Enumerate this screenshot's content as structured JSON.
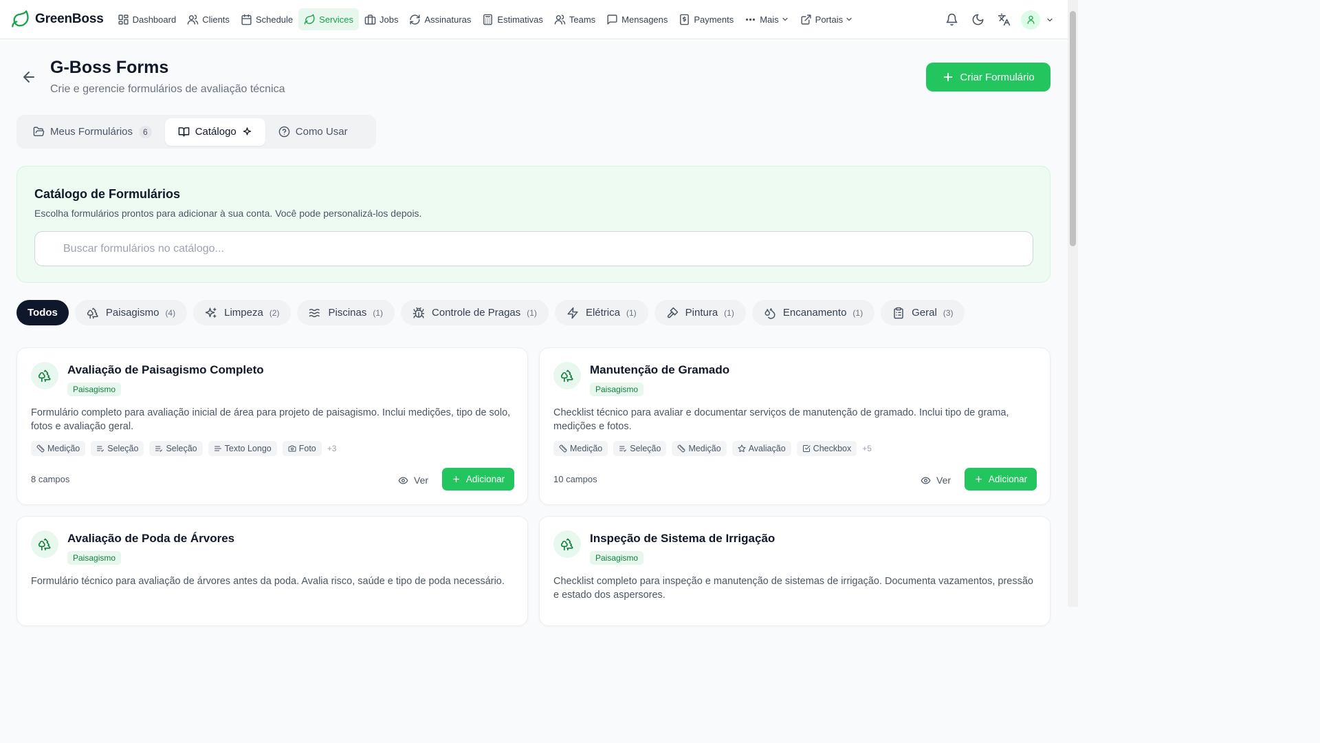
{
  "brand": {
    "name": "GreenBoss",
    "icon": "leaf-icon",
    "accent": "#22c55e"
  },
  "nav": {
    "items": [
      {
        "label": "Dashboard",
        "icon": "grid-icon"
      },
      {
        "label": "Clients",
        "icon": "users-icon"
      },
      {
        "label": "Schedule",
        "icon": "calendar-icon"
      },
      {
        "label": "Services",
        "icon": "leaf-icon",
        "active": true
      },
      {
        "label": "Jobs",
        "icon": "briefcase-icon"
      },
      {
        "label": "Assinaturas",
        "icon": "refresh-icon"
      },
      {
        "label": "Estimativas",
        "icon": "calculator-icon"
      },
      {
        "label": "Teams",
        "icon": "team-icon"
      },
      {
        "label": "Mensagens",
        "icon": "message-icon"
      },
      {
        "label": "Payments",
        "icon": "dollar-icon"
      },
      {
        "label": "Mais",
        "icon": "dots-icon"
      },
      {
        "label": "Portais",
        "icon": "external-link-icon"
      }
    ]
  },
  "header": {
    "title": "G-Boss Forms",
    "subtitle": "Crie e gerencie formulários de avaliação técnica",
    "create_label": "Criar Formulário"
  },
  "tabs": [
    {
      "label": "Meus Formulários",
      "count": "6",
      "icon": "folder-icon"
    },
    {
      "label": "Catálogo",
      "icon": "book-icon",
      "active": true
    },
    {
      "label": "Como Usar",
      "icon": "help-icon"
    }
  ],
  "catalog": {
    "title": "Catálogo de Formulários",
    "description": "Escolha formulários prontos para adicionar à sua conta. Você pode personalizá-los depois.",
    "search_placeholder": "Buscar formulários no catálogo..."
  },
  "categories": [
    {
      "label": "Todos",
      "active": true
    },
    {
      "label": "Paisagismo",
      "count": "(4)",
      "icon": "tree-icon"
    },
    {
      "label": "Limpeza",
      "count": "(2)",
      "icon": "sparkles-icon"
    },
    {
      "label": "Piscinas",
      "count": "(1)",
      "icon": "waves-icon"
    },
    {
      "label": "Controle de Pragas",
      "count": "(1)",
      "icon": "bug-icon"
    },
    {
      "label": "Elétrica",
      "count": "(1)",
      "icon": "zap-icon"
    },
    {
      "label": "Pintura",
      "count": "(1)",
      "icon": "paintbrush-icon"
    },
    {
      "label": "Encanamento",
      "count": "(1)",
      "icon": "droplets-icon"
    },
    {
      "label": "Geral",
      "count": "(3)",
      "icon": "clipboard-icon"
    }
  ],
  "forms": [
    {
      "title": "Avaliação de Paisagismo Completo",
      "category": "Paisagismo",
      "description": "Formulário completo para avaliação inicial de área para projeto de paisagismo. Inclui medições, tipo de solo, fotos e avaliação geral.",
      "fields": [
        {
          "label": "Medição",
          "icon": "ruler-icon"
        },
        {
          "label": "Seleção",
          "icon": "list-check-icon"
        },
        {
          "label": "Seleção",
          "icon": "list-check-icon"
        },
        {
          "label": "Texto Longo",
          "icon": "text-lines-icon"
        },
        {
          "label": "Foto",
          "icon": "camera-icon"
        }
      ],
      "more": "+3",
      "field_count": "8 campos",
      "view_label": "Ver",
      "add_label": "Adicionar"
    },
    {
      "title": "Manutenção de Gramado",
      "category": "Paisagismo",
      "description": "Checklist técnico para avaliar e documentar serviços de manutenção de gramado. Inclui tipo de grama, medições e fotos.",
      "fields": [
        {
          "label": "Medição",
          "icon": "ruler-icon"
        },
        {
          "label": "Seleção",
          "icon": "list-check-icon"
        },
        {
          "label": "Medição",
          "icon": "ruler-icon"
        },
        {
          "label": "Avaliação",
          "icon": "star-icon"
        },
        {
          "label": "Checkbox",
          "icon": "checkbox-icon"
        }
      ],
      "more": "+5",
      "field_count": "10 campos",
      "view_label": "Ver",
      "add_label": "Adicionar"
    },
    {
      "title": "Avaliação de Poda de Árvores",
      "category": "Paisagismo",
      "description": "Formulário técnico para avaliação de árvores antes da poda. Avalia risco, saúde e tipo de poda necessário."
    },
    {
      "title": "Inspeção de Sistema de Irrigação",
      "category": "Paisagismo",
      "description": "Checklist completo para inspeção e manutenção de sistemas de irrigação. Documenta vazamentos, pressão e estado dos aspersores."
    }
  ]
}
